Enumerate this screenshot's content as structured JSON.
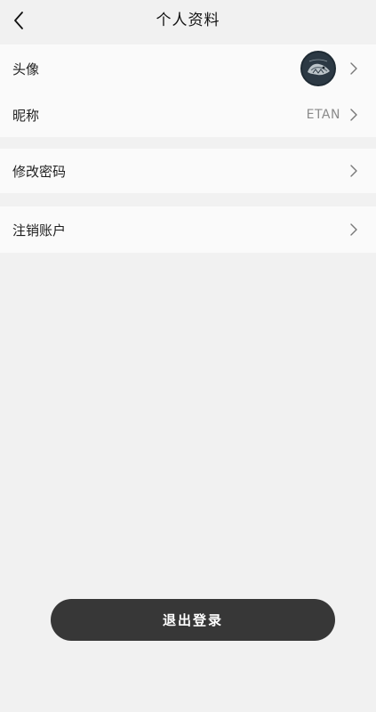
{
  "header": {
    "title": "个人资料",
    "back_icon": "chevron-left-icon"
  },
  "profile": {
    "avatar_row": {
      "label": "头像",
      "icon": "avatar-image"
    },
    "nickname_row": {
      "label": "昵称",
      "value": "ETAN"
    }
  },
  "password_row": {
    "label": "修改密码"
  },
  "cancel_account_row": {
    "label": "注销账户"
  },
  "logout": {
    "label": "退出登录"
  },
  "colors": {
    "background": "#f1f1f1",
    "card": "#fafafa",
    "button": "#373737",
    "button_text": "#ffffff",
    "secondary_text": "#8b8b8b"
  }
}
